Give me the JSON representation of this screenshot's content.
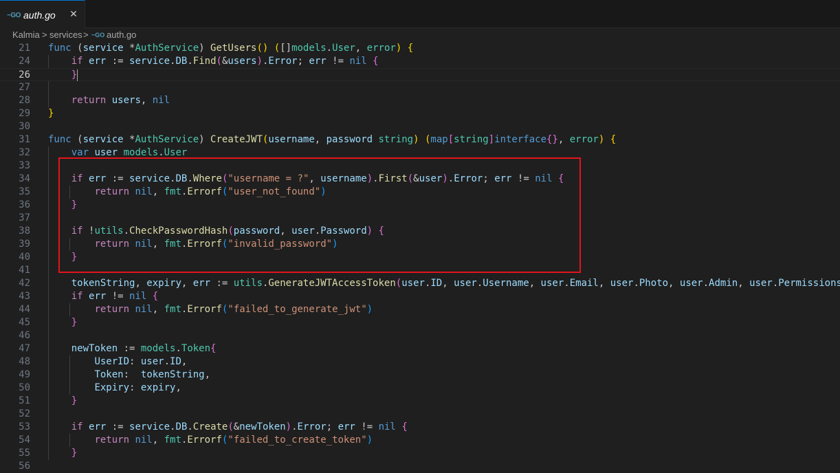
{
  "tab": {
    "icon": "go-file-icon",
    "icon_text": "~GO",
    "title": "auth.go",
    "close_glyph": "✕"
  },
  "breadcrumb": {
    "items": [
      "Kalmia",
      "services",
      "auth.go"
    ],
    "separator": ">",
    "file_icon_text": "~GO"
  },
  "editor": {
    "active_line": "26",
    "lines": [
      {
        "n": "21",
        "tokens": [
          [
            "kw",
            "func"
          ],
          [
            "p",
            " ("
          ],
          [
            "v",
            "service"
          ],
          [
            "p",
            " *"
          ],
          [
            "t",
            "AuthService"
          ],
          [
            "p",
            ") "
          ],
          [
            "fn",
            "GetUsers"
          ],
          [
            "br1",
            "()"
          ],
          [
            "p",
            " "
          ],
          [
            "br1",
            "("
          ],
          [
            "p",
            "[]"
          ],
          [
            "t2",
            "models"
          ],
          [
            "p",
            "."
          ],
          [
            "t",
            "User"
          ],
          [
            "p",
            ", "
          ],
          [
            "t",
            "error"
          ],
          [
            "br1",
            ")"
          ],
          [
            "p",
            " "
          ],
          [
            "br1",
            "{"
          ]
        ]
      },
      {
        "n": "24",
        "tokens": [
          [
            "p",
            "    "
          ],
          [
            "kw2",
            "if"
          ],
          [
            "p",
            " "
          ],
          [
            "v",
            "err"
          ],
          [
            "p",
            " := "
          ],
          [
            "v",
            "service"
          ],
          [
            "p",
            "."
          ],
          [
            "v",
            "DB"
          ],
          [
            "p",
            "."
          ],
          [
            "fn",
            "Find"
          ],
          [
            "br2",
            "("
          ],
          [
            "p",
            "&"
          ],
          [
            "v",
            "users"
          ],
          [
            "br2",
            ")"
          ],
          [
            "p",
            "."
          ],
          [
            "v",
            "Error"
          ],
          [
            "p",
            "; "
          ],
          [
            "v",
            "err"
          ],
          [
            "p",
            " != "
          ],
          [
            "kw",
            "nil"
          ],
          [
            "p",
            " "
          ],
          [
            "br2",
            "{"
          ]
        ]
      },
      {
        "n": "26",
        "tokens": [
          [
            "p",
            "    "
          ],
          [
            "br2",
            "}"
          ]
        ],
        "cursor": true
      },
      {
        "n": "27",
        "tokens": []
      },
      {
        "n": "28",
        "tokens": [
          [
            "p",
            "    "
          ],
          [
            "kw2",
            "return"
          ],
          [
            "p",
            " "
          ],
          [
            "v",
            "users"
          ],
          [
            "p",
            ", "
          ],
          [
            "kw",
            "nil"
          ]
        ]
      },
      {
        "n": "29",
        "tokens": [
          [
            "br1",
            "}"
          ]
        ]
      },
      {
        "n": "30",
        "tokens": []
      },
      {
        "n": "31",
        "tokens": [
          [
            "kw",
            "func"
          ],
          [
            "p",
            " ("
          ],
          [
            "v",
            "service"
          ],
          [
            "p",
            " *"
          ],
          [
            "t",
            "AuthService"
          ],
          [
            "p",
            ") "
          ],
          [
            "fn",
            "CreateJWT"
          ],
          [
            "br1",
            "("
          ],
          [
            "v",
            "username"
          ],
          [
            "p",
            ", "
          ],
          [
            "v",
            "password"
          ],
          [
            "p",
            " "
          ],
          [
            "t",
            "string"
          ],
          [
            "br1",
            ")"
          ],
          [
            "p",
            " "
          ],
          [
            "br1",
            "("
          ],
          [
            "kw",
            "map"
          ],
          [
            "br2",
            "["
          ],
          [
            "t",
            "string"
          ],
          [
            "br2",
            "]"
          ],
          [
            "kw",
            "interface"
          ],
          [
            "br2",
            "{}"
          ],
          [
            "p",
            ", "
          ],
          [
            "t",
            "error"
          ],
          [
            "br1",
            ")"
          ],
          [
            "p",
            " "
          ],
          [
            "br1",
            "{"
          ]
        ]
      },
      {
        "n": "32",
        "tokens": [
          [
            "p",
            "    "
          ],
          [
            "kw",
            "var"
          ],
          [
            "p",
            " "
          ],
          [
            "v",
            "user"
          ],
          [
            "p",
            " "
          ],
          [
            "t2",
            "models"
          ],
          [
            "p",
            "."
          ],
          [
            "t",
            "User"
          ]
        ]
      },
      {
        "n": "33",
        "tokens": []
      },
      {
        "n": "34",
        "tokens": [
          [
            "p",
            "    "
          ],
          [
            "kw2",
            "if"
          ],
          [
            "p",
            " "
          ],
          [
            "v",
            "err"
          ],
          [
            "p",
            " := "
          ],
          [
            "v",
            "service"
          ],
          [
            "p",
            "."
          ],
          [
            "v",
            "DB"
          ],
          [
            "p",
            "."
          ],
          [
            "fn",
            "Where"
          ],
          [
            "br2",
            "("
          ],
          [
            "s",
            "\"username = ?\""
          ],
          [
            "p",
            ", "
          ],
          [
            "v",
            "username"
          ],
          [
            "br2",
            ")"
          ],
          [
            "p",
            "."
          ],
          [
            "fn",
            "First"
          ],
          [
            "br2",
            "("
          ],
          [
            "p",
            "&"
          ],
          [
            "v",
            "user"
          ],
          [
            "br2",
            ")"
          ],
          [
            "p",
            "."
          ],
          [
            "v",
            "Error"
          ],
          [
            "p",
            "; "
          ],
          [
            "v",
            "err"
          ],
          [
            "p",
            " != "
          ],
          [
            "kw",
            "nil"
          ],
          [
            "p",
            " "
          ],
          [
            "br2",
            "{"
          ]
        ]
      },
      {
        "n": "35",
        "tokens": [
          [
            "p",
            "        "
          ],
          [
            "kw2",
            "return"
          ],
          [
            "p",
            " "
          ],
          [
            "kw",
            "nil"
          ],
          [
            "p",
            ", "
          ],
          [
            "t2",
            "fmt"
          ],
          [
            "p",
            "."
          ],
          [
            "fn",
            "Errorf"
          ],
          [
            "br3",
            "("
          ],
          [
            "s",
            "\"user_not_found\""
          ],
          [
            "br3",
            ")"
          ]
        ]
      },
      {
        "n": "36",
        "tokens": [
          [
            "p",
            "    "
          ],
          [
            "br2",
            "}"
          ]
        ]
      },
      {
        "n": "37",
        "tokens": []
      },
      {
        "n": "38",
        "tokens": [
          [
            "p",
            "    "
          ],
          [
            "kw2",
            "if"
          ],
          [
            "p",
            " !"
          ],
          [
            "t2",
            "utils"
          ],
          [
            "p",
            "."
          ],
          [
            "fn",
            "CheckPasswordHash"
          ],
          [
            "br2",
            "("
          ],
          [
            "v",
            "password"
          ],
          [
            "p",
            ", "
          ],
          [
            "v",
            "user"
          ],
          [
            "p",
            "."
          ],
          [
            "v",
            "Password"
          ],
          [
            "br2",
            ")"
          ],
          [
            "p",
            " "
          ],
          [
            "br2",
            "{"
          ]
        ]
      },
      {
        "n": "39",
        "tokens": [
          [
            "p",
            "        "
          ],
          [
            "kw2",
            "return"
          ],
          [
            "p",
            " "
          ],
          [
            "kw",
            "nil"
          ],
          [
            "p",
            ", "
          ],
          [
            "t2",
            "fmt"
          ],
          [
            "p",
            "."
          ],
          [
            "fn",
            "Errorf"
          ],
          [
            "br3",
            "("
          ],
          [
            "s",
            "\"invalid_password\""
          ],
          [
            "br3",
            ")"
          ]
        ]
      },
      {
        "n": "40",
        "tokens": [
          [
            "p",
            "    "
          ],
          [
            "br2",
            "}"
          ]
        ]
      },
      {
        "n": "41",
        "tokens": []
      },
      {
        "n": "42",
        "tokens": [
          [
            "p",
            "    "
          ],
          [
            "v",
            "tokenString"
          ],
          [
            "p",
            ", "
          ],
          [
            "v",
            "expiry"
          ],
          [
            "p",
            ", "
          ],
          [
            "v",
            "err"
          ],
          [
            "p",
            " := "
          ],
          [
            "t2",
            "utils"
          ],
          [
            "p",
            "."
          ],
          [
            "fn",
            "GenerateJWTAccessToken"
          ],
          [
            "br2",
            "("
          ],
          [
            "v",
            "user"
          ],
          [
            "p",
            "."
          ],
          [
            "v",
            "ID"
          ],
          [
            "p",
            ", "
          ],
          [
            "v",
            "user"
          ],
          [
            "p",
            "."
          ],
          [
            "v",
            "Username"
          ],
          [
            "p",
            ", "
          ],
          [
            "v",
            "user"
          ],
          [
            "p",
            "."
          ],
          [
            "v",
            "Email"
          ],
          [
            "p",
            ", "
          ],
          [
            "v",
            "user"
          ],
          [
            "p",
            "."
          ],
          [
            "v",
            "Photo"
          ],
          [
            "p",
            ", "
          ],
          [
            "v",
            "user"
          ],
          [
            "p",
            "."
          ],
          [
            "v",
            "Admin"
          ],
          [
            "p",
            ", "
          ],
          [
            "v",
            "user"
          ],
          [
            "p",
            "."
          ],
          [
            "v",
            "Permissions"
          ],
          [
            "br2",
            ")"
          ]
        ]
      },
      {
        "n": "43",
        "tokens": [
          [
            "p",
            "    "
          ],
          [
            "kw2",
            "if"
          ],
          [
            "p",
            " "
          ],
          [
            "v",
            "err"
          ],
          [
            "p",
            " != "
          ],
          [
            "kw",
            "nil"
          ],
          [
            "p",
            " "
          ],
          [
            "br2",
            "{"
          ]
        ]
      },
      {
        "n": "44",
        "tokens": [
          [
            "p",
            "        "
          ],
          [
            "kw2",
            "return"
          ],
          [
            "p",
            " "
          ],
          [
            "kw",
            "nil"
          ],
          [
            "p",
            ", "
          ],
          [
            "t2",
            "fmt"
          ],
          [
            "p",
            "."
          ],
          [
            "fn",
            "Errorf"
          ],
          [
            "br3",
            "("
          ],
          [
            "s",
            "\"failed_to_generate_jwt\""
          ],
          [
            "br3",
            ")"
          ]
        ]
      },
      {
        "n": "45",
        "tokens": [
          [
            "p",
            "    "
          ],
          [
            "br2",
            "}"
          ]
        ]
      },
      {
        "n": "46",
        "tokens": []
      },
      {
        "n": "47",
        "tokens": [
          [
            "p",
            "    "
          ],
          [
            "v",
            "newToken"
          ],
          [
            "p",
            " := "
          ],
          [
            "t2",
            "models"
          ],
          [
            "p",
            "."
          ],
          [
            "t",
            "Token"
          ],
          [
            "br2",
            "{"
          ]
        ]
      },
      {
        "n": "48",
        "tokens": [
          [
            "p",
            "        "
          ],
          [
            "v",
            "UserID"
          ],
          [
            "p",
            ": "
          ],
          [
            "v",
            "user"
          ],
          [
            "p",
            "."
          ],
          [
            "v",
            "ID"
          ],
          [
            "p",
            ","
          ]
        ]
      },
      {
        "n": "49",
        "tokens": [
          [
            "p",
            "        "
          ],
          [
            "v",
            "Token"
          ],
          [
            "p",
            ":  "
          ],
          [
            "v",
            "tokenString"
          ],
          [
            "p",
            ","
          ]
        ]
      },
      {
        "n": "50",
        "tokens": [
          [
            "p",
            "        "
          ],
          [
            "v",
            "Expiry"
          ],
          [
            "p",
            ": "
          ],
          [
            "v",
            "expiry"
          ],
          [
            "p",
            ","
          ]
        ]
      },
      {
        "n": "51",
        "tokens": [
          [
            "p",
            "    "
          ],
          [
            "br2",
            "}"
          ]
        ]
      },
      {
        "n": "52",
        "tokens": []
      },
      {
        "n": "53",
        "tokens": [
          [
            "p",
            "    "
          ],
          [
            "kw2",
            "if"
          ],
          [
            "p",
            " "
          ],
          [
            "v",
            "err"
          ],
          [
            "p",
            " := "
          ],
          [
            "v",
            "service"
          ],
          [
            "p",
            "."
          ],
          [
            "v",
            "DB"
          ],
          [
            "p",
            "."
          ],
          [
            "fn",
            "Create"
          ],
          [
            "br2",
            "("
          ],
          [
            "p",
            "&"
          ],
          [
            "v",
            "newToken"
          ],
          [
            "br2",
            ")"
          ],
          [
            "p",
            "."
          ],
          [
            "v",
            "Error"
          ],
          [
            "p",
            "; "
          ],
          [
            "v",
            "err"
          ],
          [
            "p",
            " != "
          ],
          [
            "kw",
            "nil"
          ],
          [
            "p",
            " "
          ],
          [
            "br2",
            "{"
          ]
        ]
      },
      {
        "n": "54",
        "tokens": [
          [
            "p",
            "        "
          ],
          [
            "kw2",
            "return"
          ],
          [
            "p",
            " "
          ],
          [
            "kw",
            "nil"
          ],
          [
            "p",
            ", "
          ],
          [
            "t2",
            "fmt"
          ],
          [
            "p",
            "."
          ],
          [
            "fn",
            "Errorf"
          ],
          [
            "br3",
            "("
          ],
          [
            "s",
            "\"failed_to_create_token\""
          ],
          [
            "br3",
            ")"
          ]
        ]
      },
      {
        "n": "55",
        "tokens": [
          [
            "p",
            "    "
          ],
          [
            "br2",
            "}"
          ]
        ]
      },
      {
        "n": "56",
        "tokens": []
      }
    ]
  },
  "colors": {
    "kw": "#569cd6",
    "kw2": "#c586c0",
    "fn": "#dcdcaa",
    "t": "#4ec9b0",
    "t2": "#4ec9b0",
    "v": "#9cdcfe",
    "s": "#ce9178",
    "p": "#cccccc",
    "br1": "#ffd700",
    "br2": "#da70d6",
    "br3": "#179fff",
    "highlight_box": "#e3141c"
  }
}
